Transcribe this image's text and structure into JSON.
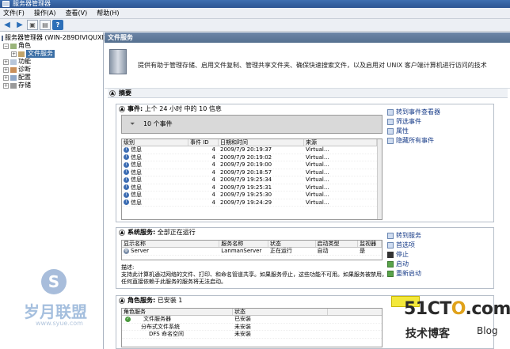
{
  "window": {
    "title": "服务器管理器"
  },
  "menu": [
    "文件(F)",
    "操作(A)",
    "查看(V)",
    "帮助(H)"
  ],
  "tree": {
    "root": "服务器管理器 (WIN-2B9DIVIQUXI)",
    "items": [
      {
        "label": "角色",
        "level": 1,
        "expander": "−"
      },
      {
        "label": "文件服务",
        "level": 2,
        "selected": true
      },
      {
        "label": "功能",
        "level": 1,
        "expander": "+"
      },
      {
        "label": "诊断",
        "level": 1,
        "expander": "+"
      },
      {
        "label": "配置",
        "level": 1,
        "expander": "+"
      },
      {
        "label": "存储",
        "level": 1,
        "expander": "+"
      }
    ]
  },
  "main": {
    "header": "文件服务",
    "description": "提供有助于管理存储、启用文件复制、管理共享文件夹、确保快速搜索文件，以及启用对 UNIX 客户端计算机进行访问的技术",
    "summary_label": "摘要"
  },
  "events": {
    "title_prefix": "事件:",
    "title_rest": "上个 24 小时 中的 10 信息",
    "filter_text": "10 个事件",
    "columns": [
      "级别",
      "事件 ID",
      "日期和时间",
      "来源"
    ],
    "rows": [
      [
        "信息",
        "4",
        "2009/7/9 20:19:37",
        "Virtual..."
      ],
      [
        "信息",
        "4",
        "2009/7/9 20:19:02",
        "Virtual..."
      ],
      [
        "信息",
        "4",
        "2009/7/9 20:19:00",
        "Virtual..."
      ],
      [
        "信息",
        "4",
        "2009/7/9 20:18:57",
        "Virtual..."
      ],
      [
        "信息",
        "4",
        "2009/7/9 19:25:34",
        "Virtual..."
      ],
      [
        "信息",
        "4",
        "2009/7/9 19:25:31",
        "Virtual..."
      ],
      [
        "信息",
        "4",
        "2009/7/9 19:25:30",
        "Virtual..."
      ],
      [
        "信息",
        "4",
        "2009/7/9 19:24:29",
        "Virtual..."
      ]
    ],
    "actions": [
      "转到事件查看器",
      "筛选事件",
      "属性",
      "隐藏所有事件"
    ]
  },
  "services": {
    "title_prefix": "系统服务:",
    "title_rest": "全部正在运行",
    "columns": [
      "显示名称",
      "服务名称",
      "状态",
      "启动类型",
      "监视器"
    ],
    "rows": [
      [
        "Server",
        "LanmanServer",
        "正在运行",
        "自动",
        "是"
      ]
    ],
    "description_label": "描述:",
    "description_text": "支持此计算机通过网络的文件、打印、和命名管道共享。如果服务停止，这些功能不可用。如果服务被禁用，任何直接依赖于此服务的服务将无法启动。",
    "actions": [
      "转到服务",
      "首选项",
      "停止",
      "启动",
      "重新启动"
    ]
  },
  "roles": {
    "title_prefix": "角色服务:",
    "title_rest": "已安装 1",
    "columns": [
      "角色服务",
      "状态"
    ],
    "rows": [
      [
        "文件服务器",
        "已安装"
      ],
      [
        "分布式文件系统",
        "未安装"
      ],
      [
        "DFS 命名空间",
        "未安装"
      ]
    ]
  },
  "watermarks": {
    "left_badge": "S",
    "left_name": "岁月联盟",
    "left_url": "www.syue.com",
    "right_brand_a": "51CT",
    "right_brand_o": "O",
    "right_brand_b": ".com",
    "right_sub": "技术博客",
    "right_blog": "Blog"
  }
}
